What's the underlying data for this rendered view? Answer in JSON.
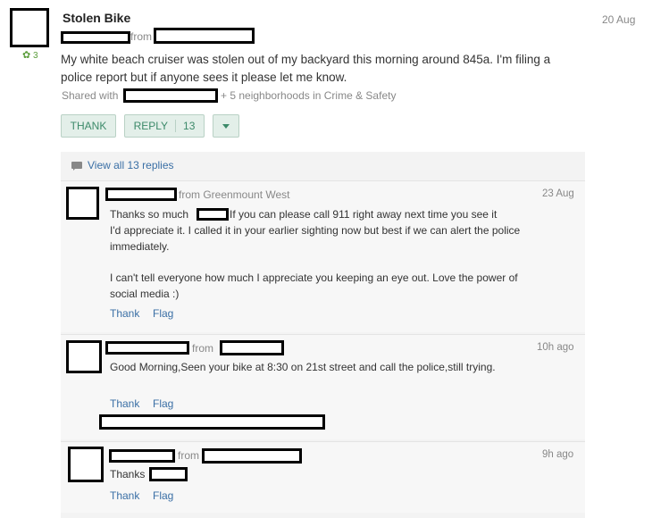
{
  "post": {
    "title": "Stolen Bike",
    "date": "20 Aug",
    "from_word": "from",
    "likes": "3",
    "body": "My white beach cruiser was stolen out of my backyard this morning around 845a. I'm filing a police report but if anyone sees it please let me know.",
    "shared_prefix": "Shared with",
    "shared_suffix": "+ 5 neighborhoods in Crime & Safety"
  },
  "actions": {
    "thank": "THANK",
    "reply": "REPLY",
    "reply_count": "13"
  },
  "replies_header": {
    "view_all": "View all 13 replies"
  },
  "replies": [
    {
      "from": "from Greenmount West",
      "time": "23 Aug",
      "body_a": "Thanks so much",
      "body_b": "If you can please call 911 right away next time you see it",
      "body_c": "I'd appreciate it. I called it in your earlier sighting now but best if we can alert the police immediately.",
      "body_d": "I can't tell everyone how much I appreciate you keeping an eye out. Love the power of social media :)",
      "thank": "Thank",
      "flag": "Flag"
    },
    {
      "from": "from",
      "time": "10h ago",
      "body": "Good Morning,Seen your bike at 8:30 on 21st street and call the police,still trying.",
      "thank": "Thank",
      "flag": "Flag"
    },
    {
      "from": "from",
      "time": "9h ago",
      "body": "Thanks",
      "thank": "Thank",
      "flag": "Flag"
    }
  ],
  "colors": {
    "link": "#3a6fa5",
    "button_bg": "#e3efe9",
    "button_text": "#3d8a6a",
    "muted": "#888888"
  },
  "icons": {
    "likes": "leaf-icon",
    "view_all": "speech-bubble-icon",
    "more": "caret-down-icon"
  }
}
